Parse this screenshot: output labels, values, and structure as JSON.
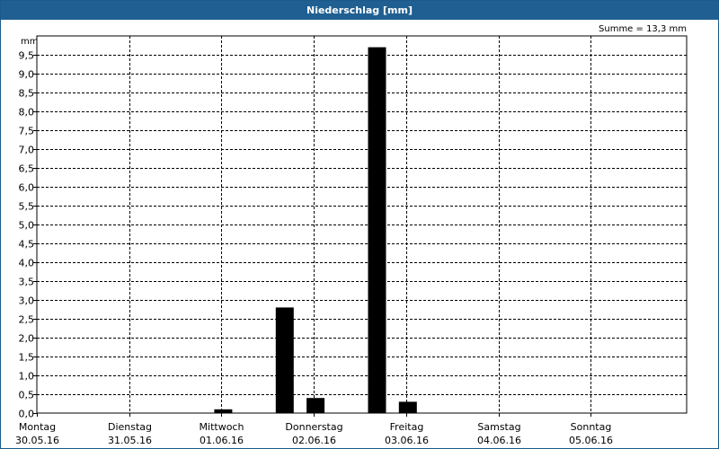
{
  "window": {
    "title": "Niederschlag [mm]"
  },
  "summary": {
    "text": "Summe = 13,3 mm"
  },
  "chart_data": {
    "type": "bar",
    "title": "Niederschlag [mm]",
    "ylabel": "mm",
    "ylim": [
      0,
      10
    ],
    "yticks": [
      "0,0",
      "0,5",
      "1,0",
      "1,5",
      "2,0",
      "2,5",
      "3,0",
      "3,5",
      "4,0",
      "4,5",
      "5,0",
      "5,5",
      "6,0",
      "6,5",
      "7,0",
      "7,5",
      "8,0",
      "8,5",
      "9,0",
      "9,5"
    ],
    "grid": true,
    "days": [
      {
        "name": "Montag",
        "date": "30.05.16"
      },
      {
        "name": "Dienstag",
        "date": "31.05.16"
      },
      {
        "name": "Mittwoch",
        "date": "01.06.16"
      },
      {
        "name": "Donnerstag",
        "date": "02.06.16"
      },
      {
        "name": "Freitag",
        "date": "03.06.16"
      },
      {
        "name": "Samstag",
        "date": "04.06.16"
      },
      {
        "name": "Sonntag",
        "date": "05.06.16"
      }
    ],
    "bars": [
      {
        "day": 2,
        "slot": 0,
        "value": 0.1
      },
      {
        "day": 2,
        "slot": 2,
        "value": 2.8
      },
      {
        "day": 3,
        "slot": 0,
        "value": 0.4
      },
      {
        "day": 3,
        "slot": 2,
        "value": 9.7
      },
      {
        "day": 4,
        "slot": 0,
        "value": 0.3
      }
    ],
    "bar_color": "#000000",
    "total": 13.3
  }
}
